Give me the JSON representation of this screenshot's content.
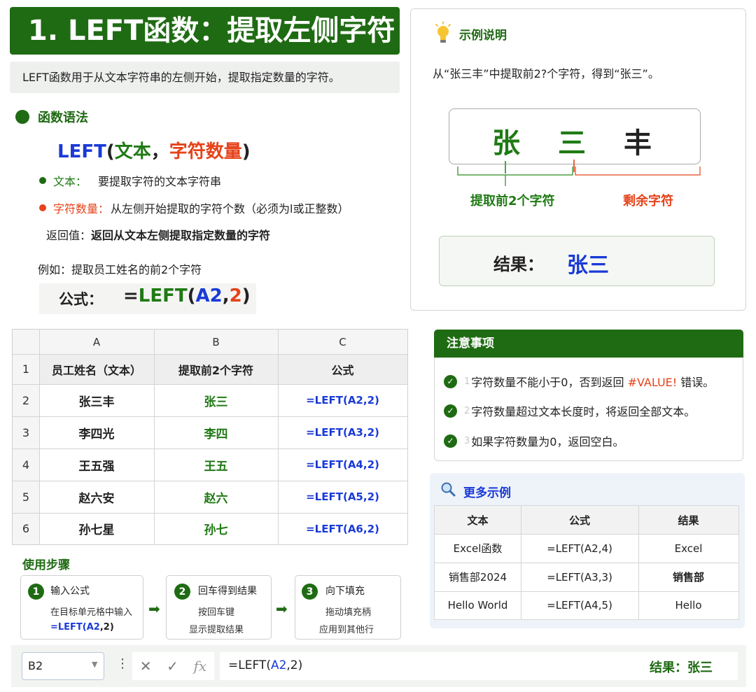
{
  "header": {
    "title": "1. LEFT函数：提取左侧字符",
    "intro": "LEFT函数用于从文本字符串的左侧开始，提取指定数量的字符。"
  },
  "syntax": {
    "heading": "函数语法",
    "formula": {
      "fn": "LEFT",
      "open": "(",
      "arg1": "文本",
      "comma": "，",
      "arg2": "字符数量",
      "close": ")"
    },
    "param_text_label": "文本：",
    "param_text_desc": "要提取字符的文本字符串",
    "param_count_label": "字符数量：",
    "param_count_desc": "从左侧开始提取的字符个数（必须为l或正整数）",
    "return_label": "返回值：",
    "return_desc": "返回从文本左侧提取指定数量的字符",
    "example_line": "例如：提取员工姓名的前2个字符",
    "formula_label": "公式：",
    "formula_value": {
      "eq": "=",
      "fn": "LEFT",
      "open": "(",
      "ref": "A2",
      "comma": ",",
      "num": "2",
      "close": ")"
    }
  },
  "example_panel": {
    "title": "示例说明",
    "desc": "从“张三丰”中提取前2?个字符，得到“张三”。",
    "chars": [
      "张",
      "三",
      "丰"
    ],
    "extract_label": "提取前2个字符",
    "remain_label": "剩余字符",
    "result_label": "结果：",
    "result_value": "张三"
  },
  "sheet": {
    "col_headers": [
      "A",
      "B",
      "C"
    ],
    "row_numbers": [
      "1",
      "2",
      "3",
      "4",
      "5",
      "6"
    ],
    "header_row": [
      "员工姓名（文本）",
      "提取前2个字符",
      "公式"
    ],
    "rows": [
      {
        "name": "张三丰",
        "result": "张三",
        "f_pre": "=LEFT(",
        "f_ref": "A2",
        "f_post": ",2)"
      },
      {
        "name": "李四光",
        "result": "李四",
        "f_pre": "=LEFT(",
        "f_ref": "A3",
        "f_post": ",2)"
      },
      {
        "name": "王五强",
        "result": "王五",
        "f_pre": "=LEFT(",
        "f_ref": "A4",
        "f_post": ",2)"
      },
      {
        "name": "赵六安",
        "result": "赵六",
        "f_pre": "=LEFT(",
        "f_ref": "A5",
        "f_post": ",2)"
      },
      {
        "name": "孙七星",
        "result": "孙七",
        "f_pre": "=LEFT(",
        "f_ref": "A6",
        "f_post": ",2)"
      }
    ]
  },
  "notes": {
    "title": "注意事项",
    "items": [
      {
        "idx": "1",
        "pre": "字符数量不能小于0，否到返回 ",
        "highlight": "#VALUE!",
        "post": " 错误。"
      },
      {
        "idx": "2",
        "pre": "字符数量超过文本长度时，将返回全部文本。",
        "highlight": "",
        "post": ""
      },
      {
        "idx": "3",
        "pre": "如果字符数量为0，返回空白。",
        "highlight": "",
        "post": ""
      }
    ]
  },
  "more_examples": {
    "title": "更多示例",
    "headers": [
      "文本",
      "公式",
      "结果"
    ],
    "rows": [
      [
        "Excel函数",
        "=LEFT(A2,4)",
        "Excel"
      ],
      [
        "销售部2024",
        "=LEFT(A3,3)",
        "销售部"
      ],
      [
        "Hello World",
        "=LEFT(A4,5)",
        "Hello"
      ]
    ]
  },
  "steps": {
    "title": "使用步骤",
    "items": [
      {
        "num": "1",
        "title": "输入公式",
        "line1": "在目标单元格中输入",
        "line2_pre": "=LEFT(",
        "line2_ref": "A2",
        "line2_post": ",2)"
      },
      {
        "num": "2",
        "title": "回车得到结果",
        "line1": "按回车键",
        "line2": "显示提取结果"
      },
      {
        "num": "3",
        "title": "向下填充",
        "line1": "拖动填充柄",
        "line2": "应用到其他行"
      }
    ]
  },
  "formula_bar": {
    "name_box": "B2",
    "formula_pre": "=LEFT(",
    "formula_ref": "A2",
    "formula_post": ",2)",
    "result": "结果：张三"
  },
  "colors": {
    "dark_green": "#1f6b13",
    "green": "#1f7a14",
    "blue": "#1a3ad6",
    "red": "#e5431a"
  },
  "icons": [
    "lightbulb-icon",
    "check-icon",
    "search-icon",
    "arrow-right-icon",
    "dropdown-icon",
    "more-icon",
    "cancel-icon",
    "enter-icon",
    "function-icon"
  ]
}
